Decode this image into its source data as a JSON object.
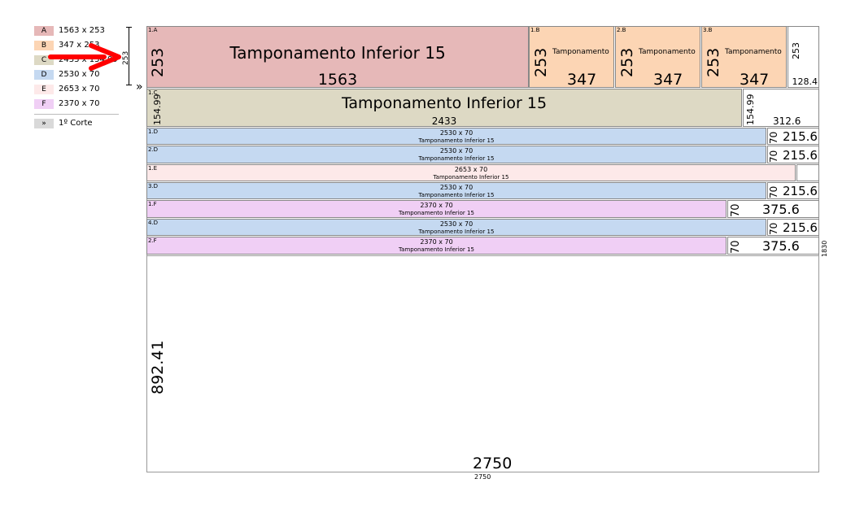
{
  "colors": {
    "A": "#e6b8b8",
    "B": "#fcd5b4",
    "C": "#ddd9c4",
    "D": "#c5d9f1",
    "E": "#fde9e9",
    "F": "#f0cff5",
    "corte": "#d9d9d9",
    "arrow": "#ff0000"
  },
  "legend": {
    "items": [
      {
        "key": "A",
        "size": "1563 x 253"
      },
      {
        "key": "B",
        "size": "347 x 253"
      },
      {
        "key": "C",
        "size": "2433 x 154.99"
      },
      {
        "key": "D",
        "size": "2530 x 70"
      },
      {
        "key": "E",
        "size": "2653 x 70"
      },
      {
        "key": "F",
        "size": "2370 x 70"
      }
    ],
    "cut": {
      "key": "»",
      "label": "1º Corte"
    }
  },
  "strip_marker": {
    "height_label": "253",
    "marker": "»"
  },
  "sheet": {
    "width_label": "2750",
    "width_label_small": "2750",
    "height_label": "1830",
    "remaining_height": "892.41"
  },
  "pieces": {
    "a1": {
      "tag": "1.A",
      "title": "Tamponamento Inferior 15",
      "width": "1563",
      "height": "253"
    },
    "b1": {
      "tag": "1.B",
      "title": "Tamponamento",
      "width": "347",
      "height": "253"
    },
    "b2": {
      "tag": "2.B",
      "title": "Tamponamento",
      "width": "347",
      "height": "253"
    },
    "b3": {
      "tag": "3.B",
      "title": "Tamponamento",
      "width": "347",
      "height": "253"
    },
    "c1": {
      "tag": "1.C",
      "title": "Tamponamento Inferior 15",
      "width": "2433",
      "height": "154.99"
    },
    "d1": {
      "tag": "1.D",
      "size": "2530 x 70",
      "title": "Tamponamento Inferior 15"
    },
    "d2": {
      "tag": "2.D",
      "size": "2530 x 70",
      "title": "Tamponamento Inferior 15"
    },
    "e1": {
      "tag": "1.E",
      "size": "2653 x 70",
      "title": "Tamponamento Inferior 15"
    },
    "d3": {
      "tag": "3.D",
      "size": "2530 x 70",
      "title": "Tamponamento Inferior 15"
    },
    "f1": {
      "tag": "1.F",
      "size": "2370 x 70",
      "title": "Tamponamento Inferior 15"
    },
    "d4": {
      "tag": "4.D",
      "size": "2530 x 70",
      "title": "Tamponamento Inferior 15"
    },
    "f2": {
      "tag": "2.F",
      "size": "2370 x 70",
      "title": "Tamponamento Inferior 15"
    }
  },
  "waste": {
    "row1": {
      "height": "253",
      "width": "128.4"
    },
    "row2": {
      "height": "154.99",
      "width": "312.6"
    },
    "d1": {
      "height": "70",
      "width": "215.6"
    },
    "d2": {
      "height": "70",
      "width": "215.6"
    },
    "d3": {
      "height": "70",
      "width": "215.6"
    },
    "f1": {
      "height": "70",
      "width": "375.6"
    },
    "d4": {
      "height": "70",
      "width": "215.6"
    },
    "f2": {
      "height": "70",
      "width": "375.6"
    }
  }
}
